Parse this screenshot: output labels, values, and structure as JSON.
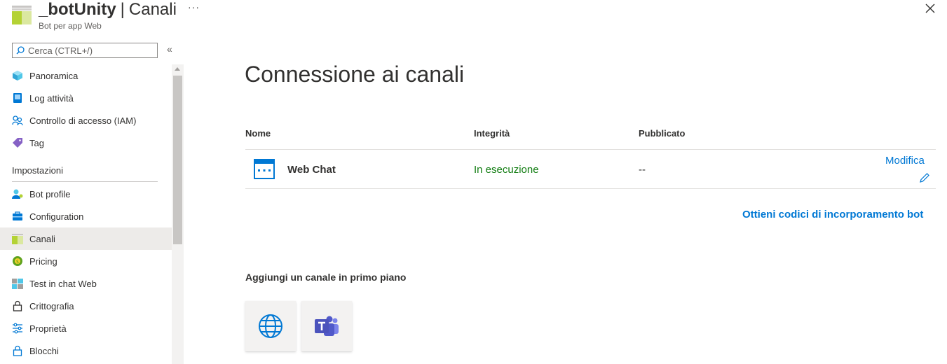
{
  "header": {
    "resource_name": "_botUnity",
    "separator": "|",
    "page_name": "Canali",
    "subtitle": "Bot per app Web",
    "more_label": "···",
    "close_icon": "close-icon"
  },
  "search": {
    "placeholder": "Cerca (CTRL+/)",
    "value": "",
    "collapse_label": "«"
  },
  "sidebar": {
    "items": [
      {
        "label": "Panoramica",
        "icon": "cube-icon"
      },
      {
        "label": "Log attività",
        "icon": "log-icon"
      },
      {
        "label": "Controllo di accesso (IAM)",
        "icon": "people-icon"
      },
      {
        "label": "Tag",
        "icon": "tag-icon"
      }
    ],
    "section_title": "Impostazioni",
    "settings_items": [
      {
        "label": "Bot profile",
        "icon": "bot-profile-icon"
      },
      {
        "label": "Configuration",
        "icon": "toolbox-icon"
      },
      {
        "label": "Canali",
        "icon": "channels-icon",
        "active": true
      },
      {
        "label": "Pricing",
        "icon": "pricing-icon"
      },
      {
        "label": "Test in chat Web",
        "icon": "test-chat-icon"
      },
      {
        "label": "Crittografia",
        "icon": "lock-icon"
      },
      {
        "label": "Proprietà",
        "icon": "properties-icon"
      },
      {
        "label": "Blocchi",
        "icon": "lock-icon"
      }
    ]
  },
  "main": {
    "title": "Connessione ai canali",
    "table": {
      "columns": [
        "Nome",
        "Integrità",
        "Pubblicato"
      ],
      "rows": [
        {
          "name": "Web Chat",
          "health": "In esecuzione",
          "published": "--",
          "edit_label": "Modifica",
          "icon": "web-chat-icon"
        }
      ]
    },
    "embed_link": "Ottieni codici di incorporamento bot",
    "featured": {
      "title": "Aggiungi un canale in primo piano",
      "channels": [
        {
          "icon": "globe-icon"
        },
        {
          "icon": "teams-icon"
        }
      ]
    }
  },
  "colors": {
    "accent": "#0078d4",
    "success": "#107c10",
    "active_nav": "#edebe9",
    "text": "#323130"
  }
}
